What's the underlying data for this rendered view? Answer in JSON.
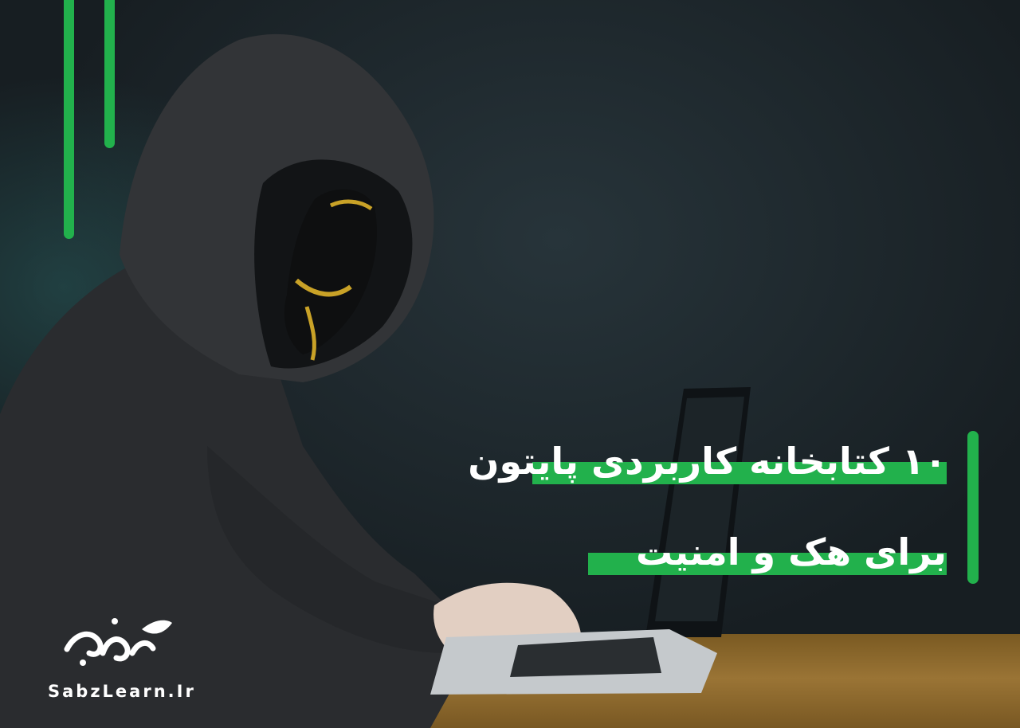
{
  "banner": {
    "title_line_1": "۱۰ کتابخانه کاربردی پایتون",
    "title_line_2": "برای هک و امنیت",
    "brand_site": "SabzLearn.Ir",
    "logo_mark_name": "sabzlearn-logo",
    "image_subject": "hooded-hacker-with-mask-at-laptop-illustration"
  },
  "colors": {
    "accent": "#22b14c",
    "background": "#1b2327",
    "text": "#ffffff",
    "table": "#8a6a2e"
  }
}
